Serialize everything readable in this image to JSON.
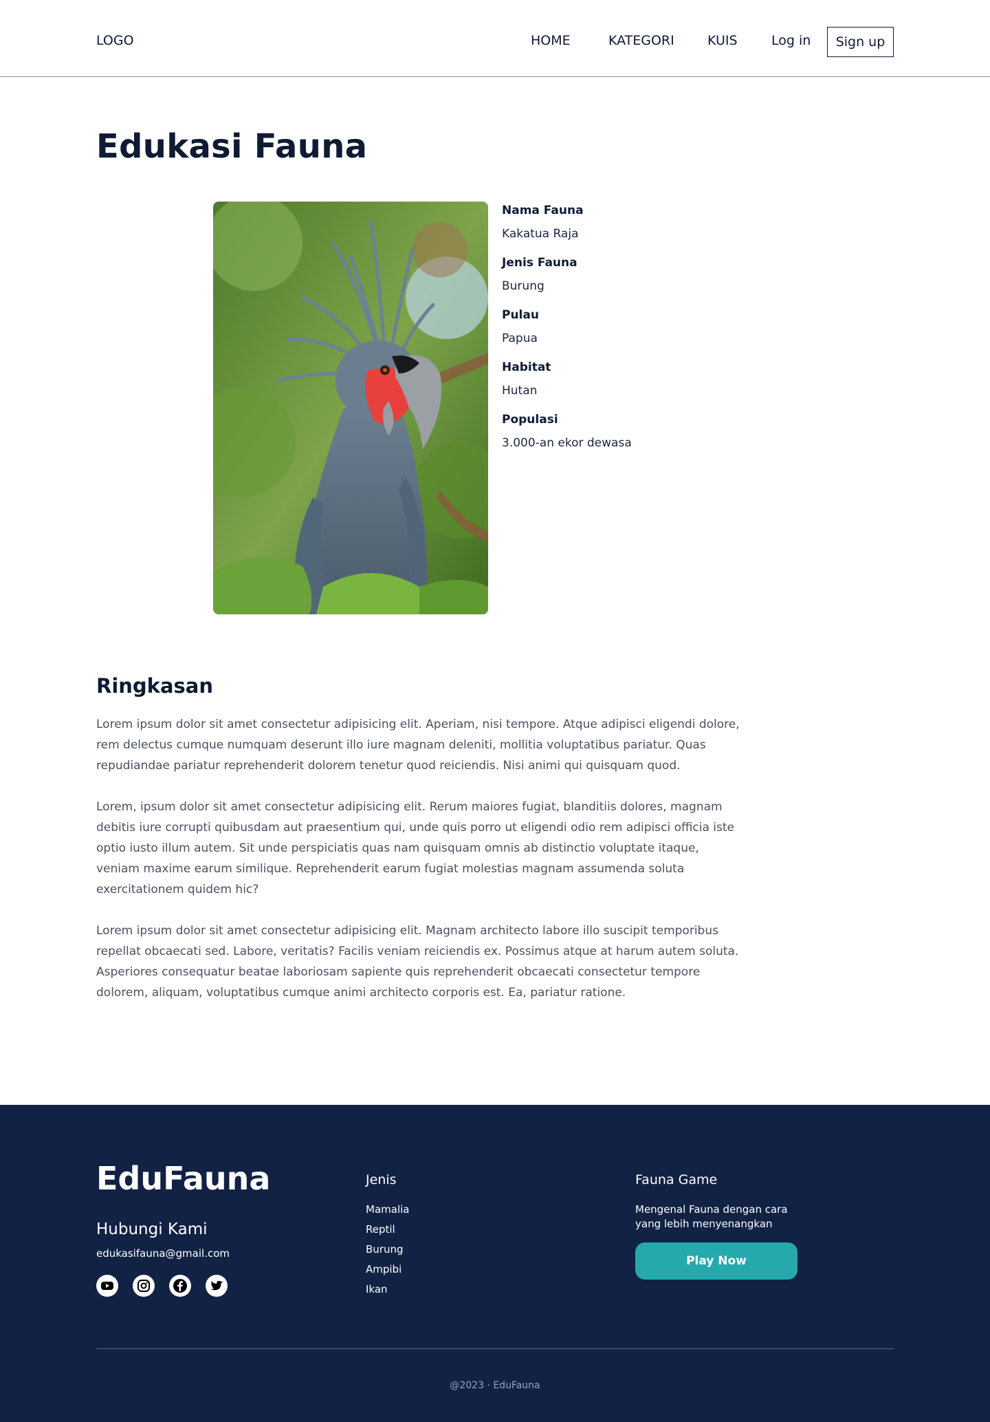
{
  "header": {
    "logo": "LOGO",
    "nav": [
      "HOME",
      "KATEGORI",
      "KUIS"
    ],
    "login": "Log in",
    "signup": "Sign up"
  },
  "main": {
    "title": "Edukasi Fauna",
    "details": [
      {
        "label": "Nama Fauna",
        "value": "Kakatua Raja"
      },
      {
        "label": "Jenis Fauna",
        "value": "Burung"
      },
      {
        "label": "Pulau",
        "value": "Papua"
      },
      {
        "label": "Habitat",
        "value": "Hutan"
      },
      {
        "label": "Populasi",
        "value": "3.000-an ekor dewasa"
      }
    ],
    "summary_title": "Ringkasan",
    "summary": [
      "Lorem ipsum dolor sit amet consectetur adipisicing elit. Aperiam, nisi tempore. Atque adipisci eligendi dolore, rem delectus cumque numquam deserunt illo iure magnam deleniti, mollitia voluptatibus pariatur. Quas repudiandae pariatur reprehenderit dolorem tenetur quod reiciendis. Nisi animi qui quisquam quod.",
      "Lorem, ipsum dolor sit amet consectetur adipisicing elit. Rerum maiores fugiat, blanditiis dolores, magnam debitis iure corrupti quibusdam aut praesentium qui, unde quis porro ut eligendi odio rem adipisci officia iste optio iusto illum autem. Sit unde perspiciatis quas nam quisquam omnis ab distinctio voluptate itaque, veniam maxime earum similique. Reprehenderit earum fugiat molestias magnam assumenda soluta exercitationem quidem hic?",
      "Lorem ipsum dolor sit amet consectetur adipisicing elit. Magnam architecto labore illo suscipit temporibus repellat obcaecati sed. Labore, veritatis? Facilis veniam reiciendis ex. Possimus atque at harum autem soluta. Asperiores consequatur beatae laboriosam sapiente quis reprehenderit obcaecati consectetur tempore dolorem, aliquam, voluptatibus cumque animi architecto corporis est. Ea, pariatur ratione."
    ]
  },
  "footer": {
    "brand": "EduFauna",
    "contact_title": "Hubungi Kami",
    "email": "edukasifauna@gmail.com",
    "socials": [
      "youtube-icon",
      "instagram-icon",
      "facebook-icon",
      "twitter-icon"
    ],
    "jenis_title": "Jenis",
    "jenis": [
      "Mamalia",
      "Reptil",
      "Burung",
      "Ampibi",
      "Ikan"
    ],
    "game_title": "Fauna Game",
    "game_desc": "Mengenal Fauna dengan cara yang lebih menyenangkan",
    "play_button": "Play Now",
    "copyright": "@2023 · EduFauna"
  },
  "colors": {
    "footer_bg": "#112244",
    "accent": "#26a9ad",
    "text_dark": "#0f1a33"
  }
}
